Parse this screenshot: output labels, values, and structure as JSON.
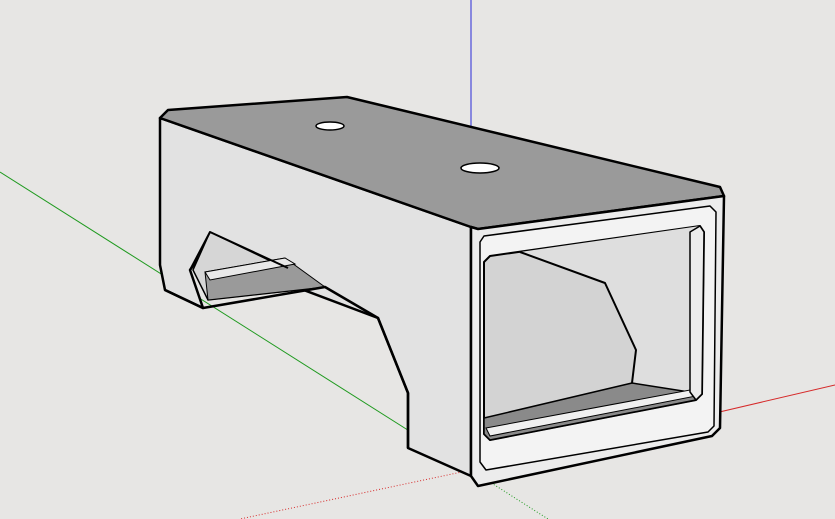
{
  "viewport": {
    "background_color": "#e7e6e4",
    "description_icon": "3d-model-viewport"
  },
  "axes": {
    "x_axis_color": "#d62a2a",
    "y_axis_color": "#1f9a1f",
    "z_axis_color": "#2a2ad8"
  },
  "model": {
    "top_face_color": "#9a9a9a",
    "side_face_color": "#e2e2e2",
    "front_face_color": "#ececec",
    "inner_face_color": "#d3d3d3",
    "shadow_face_color": "#8a8a8a",
    "edge_color": "#000000",
    "mounting_holes_count": 2
  }
}
